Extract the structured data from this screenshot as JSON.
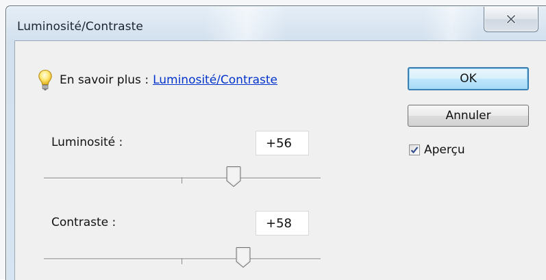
{
  "window": {
    "title": "Luminosité/Contraste",
    "close_icon": "close-x-icon"
  },
  "hint": {
    "icon": "lightbulb-icon",
    "label": "En savoir plus :",
    "link": "Luminosité/Contraste"
  },
  "brightness": {
    "label": "Luminosité :",
    "value": "+56",
    "level": 56,
    "range": [
      -150,
      150
    ]
  },
  "contrast": {
    "label": "Contraste :",
    "value": "+58",
    "level": 58,
    "range": [
      -50,
      100
    ]
  },
  "buttons": {
    "ok_label": "OK",
    "cancel_label": "Annuler"
  },
  "preview": {
    "label": "Aperçu",
    "checked": true
  },
  "colors": {
    "link": "#0033cc",
    "ok_border": "#3c7fb1",
    "check_mark": "#2f4b8c"
  }
}
